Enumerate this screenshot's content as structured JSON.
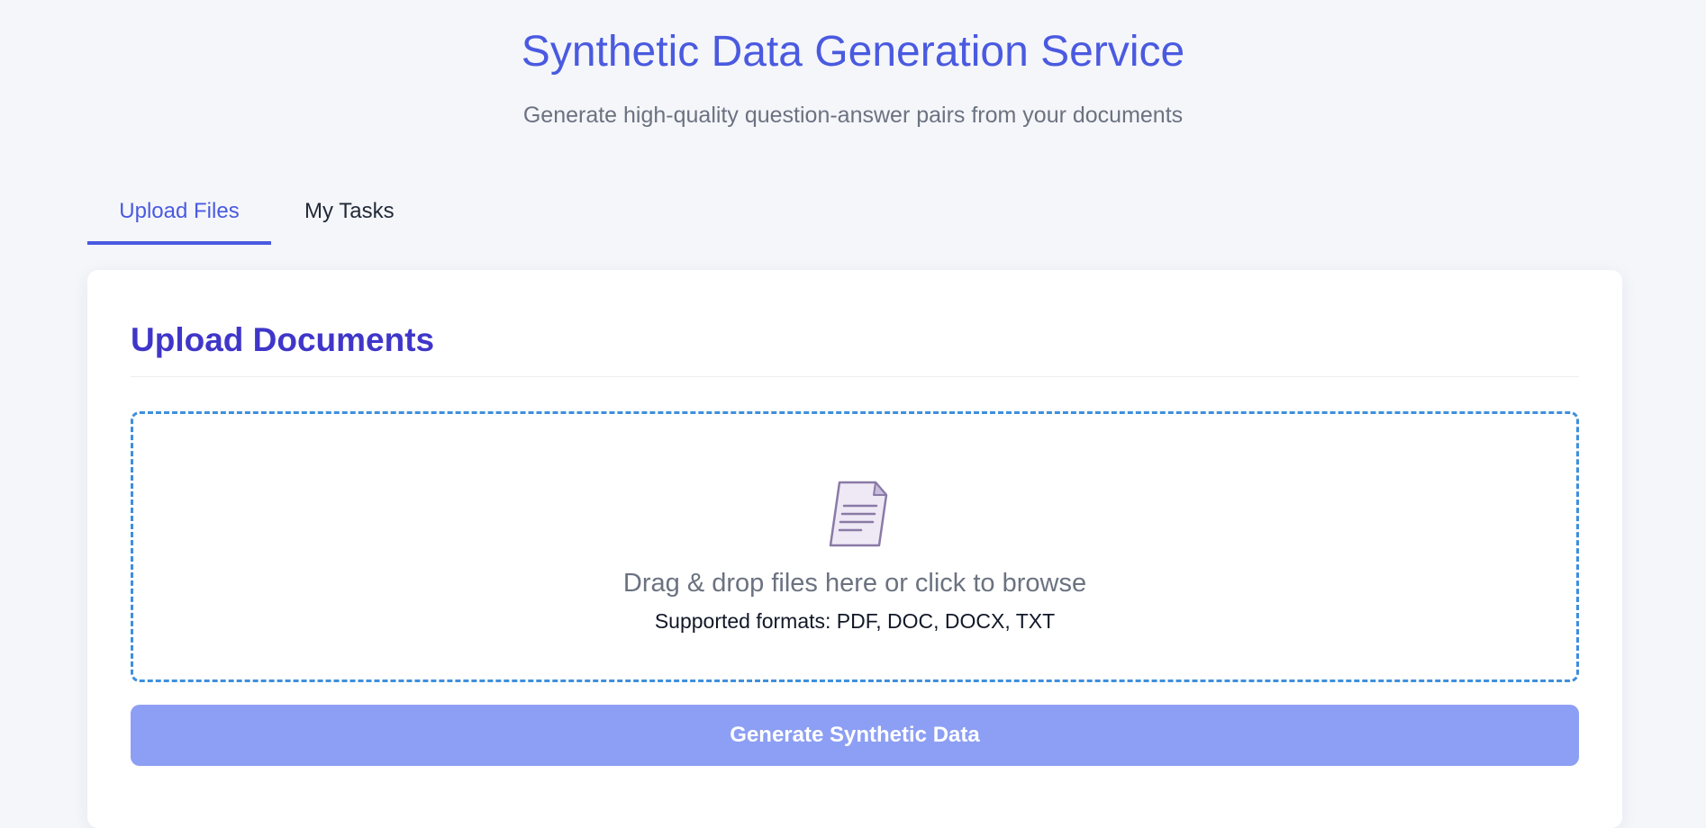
{
  "header": {
    "title": "Synthetic Data Generation Service",
    "subtitle": "Generate high-quality question-answer pairs from your documents"
  },
  "tabs": [
    {
      "label": "Upload Files",
      "active": true
    },
    {
      "label": "My Tasks",
      "active": false
    }
  ],
  "upload": {
    "title": "Upload Documents",
    "dropzone": {
      "icon": "document-icon",
      "text": "Drag & drop files here or click to browse",
      "formats": "Supported formats: PDF, DOC, DOCX, TXT"
    },
    "button_label": "Generate Synthetic Data"
  },
  "colors": {
    "accent": "#4a5ae0",
    "card_title": "#3f36c9",
    "dropzone_border": "#3f8fdc",
    "button_disabled": "#8d9ff4",
    "background": "#f5f6fa"
  }
}
